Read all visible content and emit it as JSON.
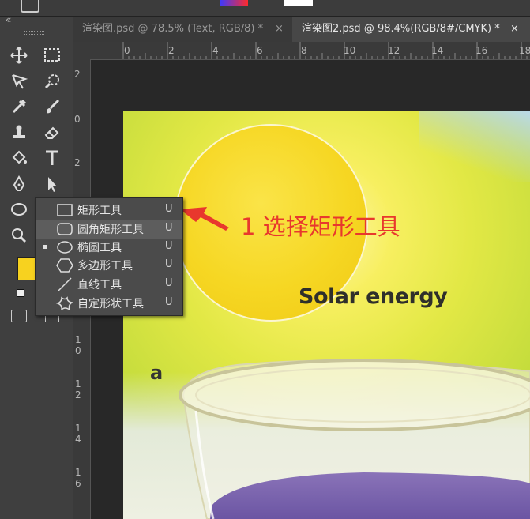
{
  "tabs": [
    {
      "label": "渲染图.psd @ 78.5% (Text, RGB/8) *",
      "close": "×",
      "active": false
    },
    {
      "label": "渲染图2.psd @ 98.4%(RGB/8#/CMYK) *",
      "close": "×",
      "active": true
    }
  ],
  "ruler_h": [
    "0",
    "2",
    "4",
    "6",
    "8",
    "10",
    "12",
    "14",
    "16",
    "18"
  ],
  "ruler_v": [
    "2",
    "0",
    "2",
    "4",
    "6",
    "8",
    "1\n0",
    "1\n2",
    "1\n4",
    "1\n6"
  ],
  "toolbar_collapse": "«",
  "tools": [
    {
      "name": "move-tool-icon"
    },
    {
      "name": "marquee-tool-icon"
    },
    {
      "name": "lasso-tool-icon"
    },
    {
      "name": "quick-select-tool-icon"
    },
    {
      "name": "eyedropper-tool-icon"
    },
    {
      "name": "brush-tool-icon"
    },
    {
      "name": "stamp-tool-icon"
    },
    {
      "name": "eraser-tool-icon"
    },
    {
      "name": "bucket-tool-icon"
    },
    {
      "name": "text-tool-icon"
    },
    {
      "name": "pen-tool-icon"
    },
    {
      "name": "path-select-tool-icon"
    },
    {
      "name": "ellipse-tool-icon"
    },
    {
      "name": "hand-tool-icon"
    },
    {
      "name": "zoom-tool-icon"
    }
  ],
  "shape_flyout": [
    {
      "icon": "rectangle-icon",
      "label": "矩形工具",
      "key": "U",
      "selected": false,
      "current": false
    },
    {
      "icon": "rounded-rectangle-icon",
      "label": "圆角矩形工具",
      "key": "U",
      "selected": true,
      "current": false
    },
    {
      "icon": "ellipse-icon",
      "label": "椭圆工具",
      "key": "U",
      "selected": false,
      "current": true
    },
    {
      "icon": "polygon-icon",
      "label": "多边形工具",
      "key": "U",
      "selected": false,
      "current": false
    },
    {
      "icon": "line-icon",
      "label": "直线工具",
      "key": "U",
      "selected": false,
      "current": false
    },
    {
      "icon": "custom-shape-icon",
      "label": "自定形状工具",
      "key": "U",
      "selected": false,
      "current": false
    }
  ],
  "canvas": {
    "heading": "Solar energy",
    "panel_label": "a",
    "annotation": "1 选择矩形工具",
    "annotation_color": "#e8382d"
  },
  "foreground_color": "#f7d21f"
}
